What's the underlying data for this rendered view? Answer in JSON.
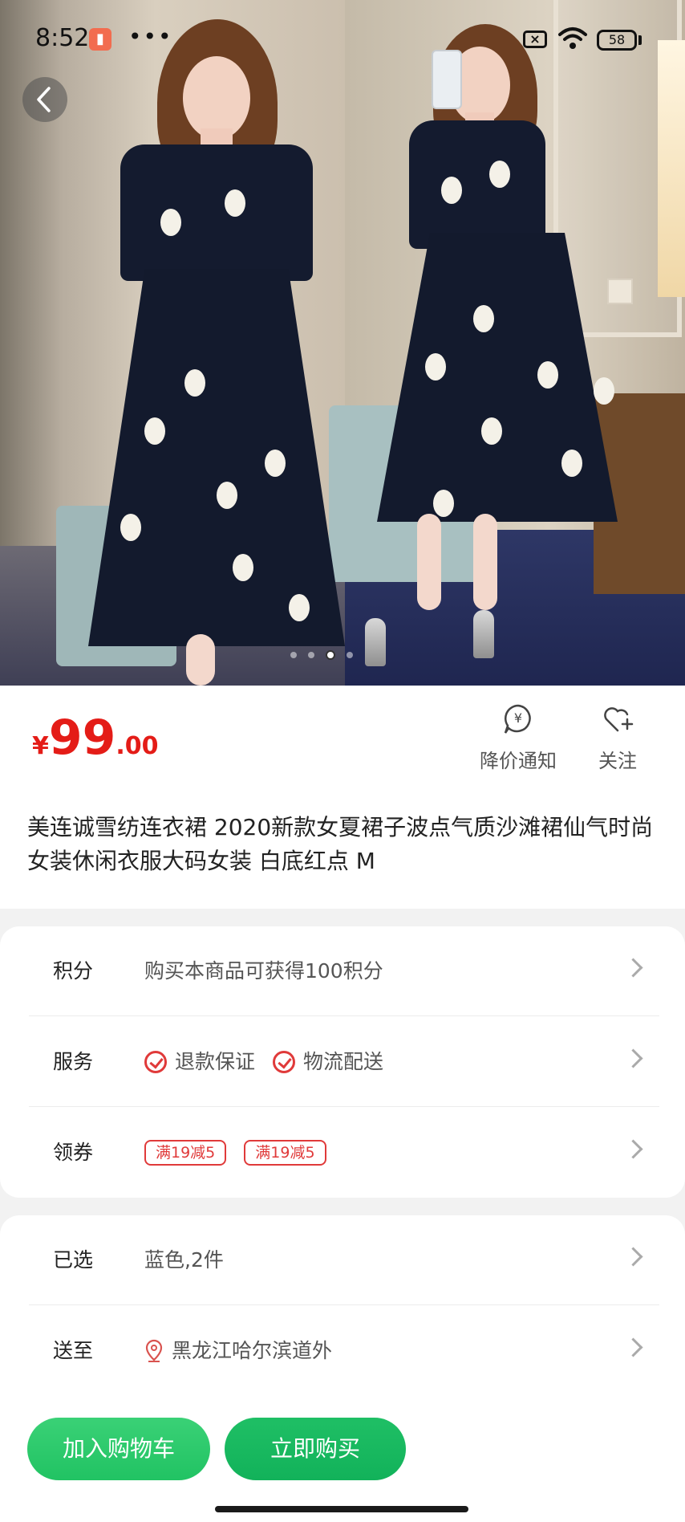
{
  "status_bar": {
    "time": "8:52",
    "battery": "58"
  },
  "gallery": {
    "page_count": 4,
    "active_page": 3
  },
  "product": {
    "currency_symbol": "¥",
    "price_int": "99",
    "price_dec": ".00",
    "title": "美连诚雪纺连衣裙 2020新款女夏裙子波点气质沙滩裙仙气时尚女装休闲衣服大码女装 白底红点 M",
    "price_notify_label": "降价通知",
    "follow_label": "关注"
  },
  "details": {
    "points": {
      "label": "积分",
      "value": "购买本商品可获得100积分"
    },
    "service": {
      "label": "服务",
      "items": [
        "退款保证",
        "物流配送"
      ]
    },
    "coupon": {
      "label": "领券",
      "items": [
        "满19减5",
        "满19减5"
      ]
    }
  },
  "selection": {
    "selected": {
      "label": "已选",
      "value": "蓝色,2件"
    },
    "ship_to": {
      "label": "送至",
      "value": "黑龙江哈尔滨道外"
    }
  },
  "bottom_bar": {
    "add_to_cart": "加入购物车",
    "buy_now": "立即购买"
  },
  "colors": {
    "price_red": "#e41c17",
    "button_green": "#21c363"
  }
}
